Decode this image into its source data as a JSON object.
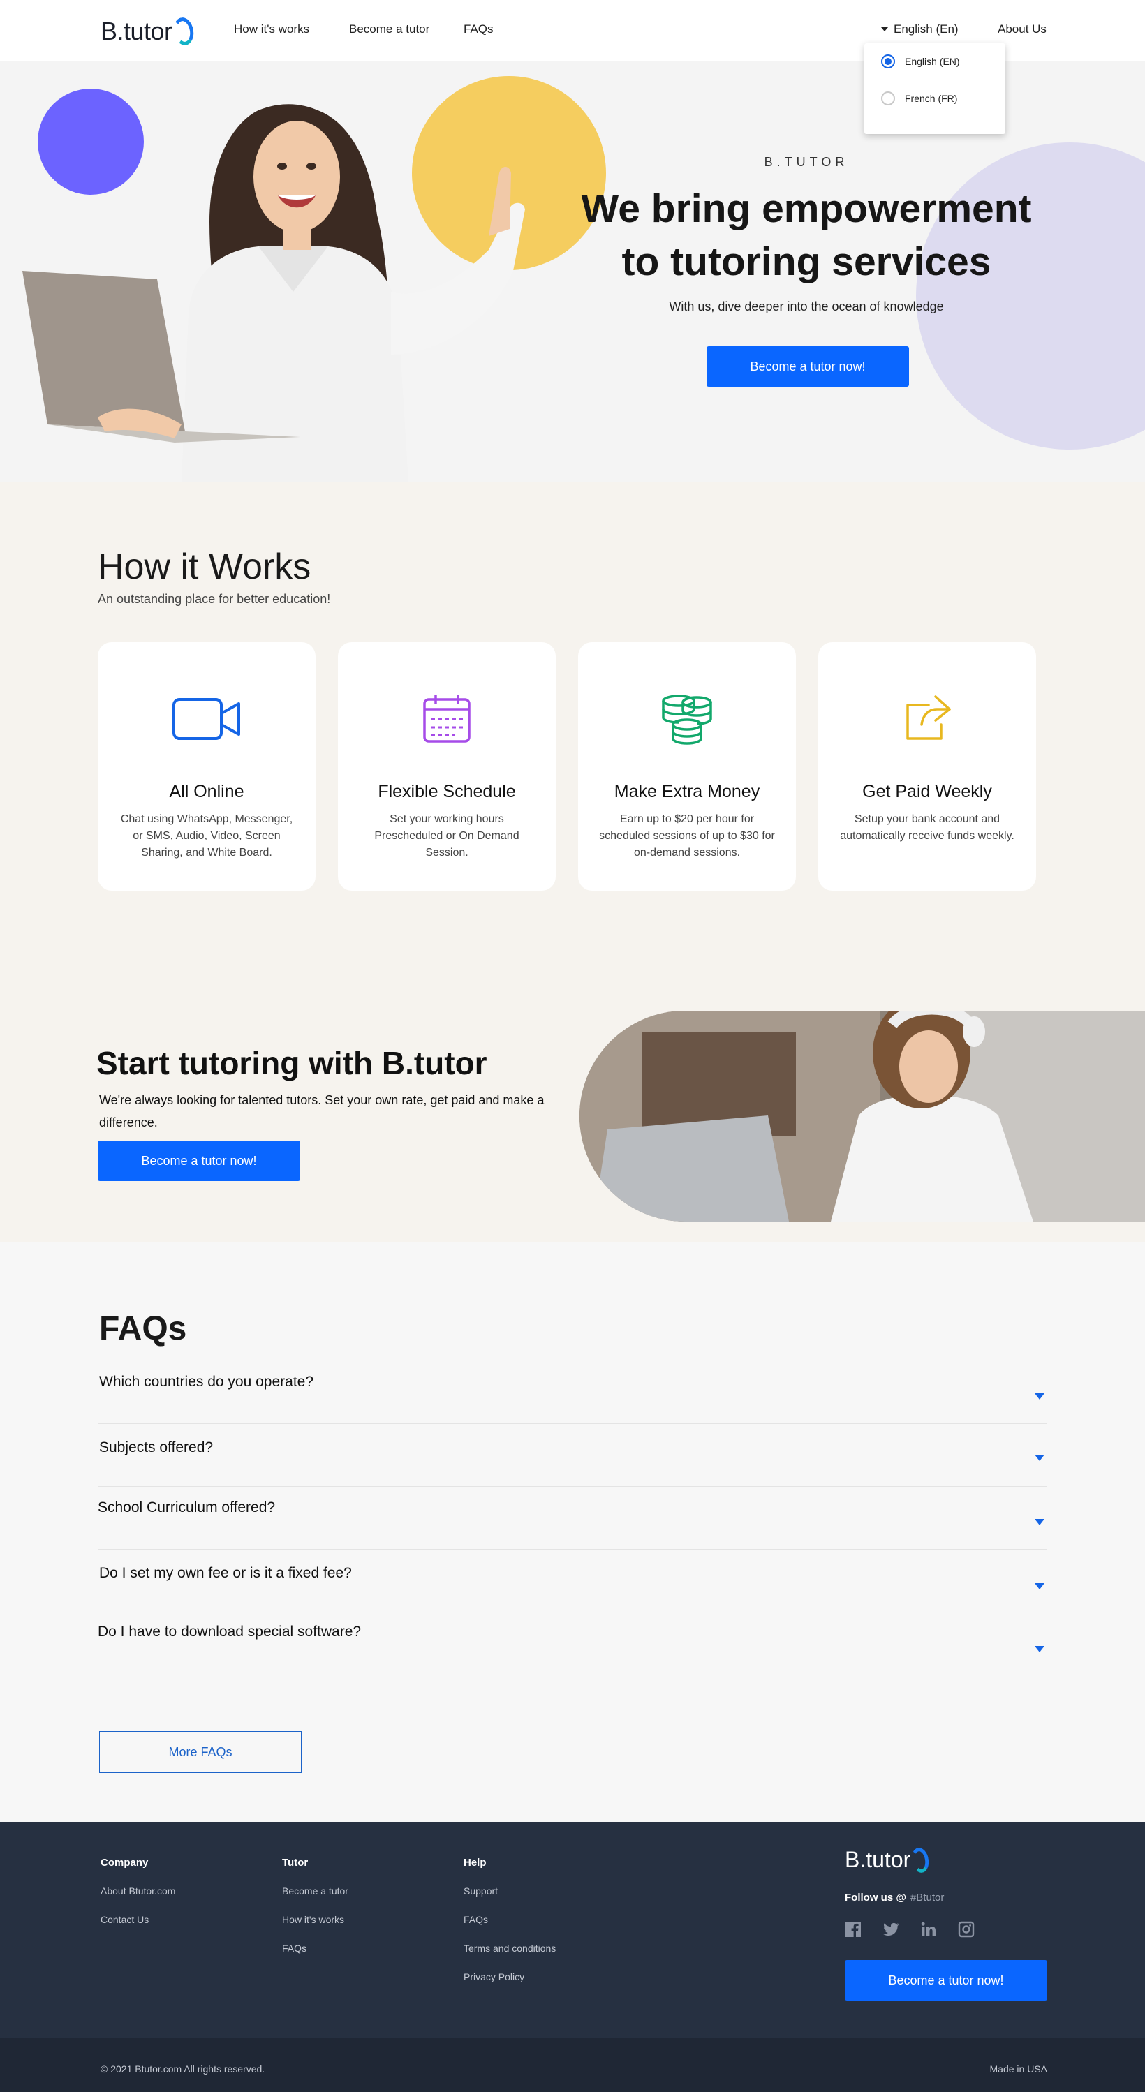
{
  "nav": {
    "logo": "B.tutor",
    "links": [
      "How it's works",
      "Become a tutor",
      "FAQs"
    ],
    "language": "English (En)",
    "about": "About Us",
    "language_menu": [
      {
        "label": "English (EN)",
        "selected": true
      },
      {
        "label": "French (FR)",
        "selected": false
      }
    ]
  },
  "hero": {
    "eyebrow": "B.TUTOR",
    "title_line1": "We bring empowerment",
    "title_line2": "to tutoring services",
    "subtitle": "With us, dive deeper into the ocean of knowledge",
    "cta": "Become a tutor now!"
  },
  "how": {
    "title": "How it Works",
    "subtitle": "An outstanding place for better education!",
    "cards": [
      {
        "icon": "video-camera-icon",
        "color": "#1565e6",
        "title": "All Online",
        "desc": "Chat using WhatsApp, Messenger, or SMS, Audio, Video, Screen Sharing, and White Board."
      },
      {
        "icon": "calendar-icon",
        "color": "#a64ce8",
        "title": "Flexible Schedule",
        "desc": "Set your working hours Prescheduled or On Demand Session."
      },
      {
        "icon": "coins-icon",
        "color": "#12a86b",
        "title": "Make Extra Money",
        "desc": "Earn up to $20 per hour for scheduled sessions of up to $30 for on-demand sessions."
      },
      {
        "icon": "share-icon",
        "color": "#e8b820",
        "title": "Get Paid Weekly",
        "desc": "Setup your bank account and automatically receive funds weekly."
      }
    ]
  },
  "start": {
    "title_prefix": "Start tutoring with ",
    "title_brand": "B.tutor",
    "text": "We're always looking for talented tutors. Set your own rate, get paid and make a difference.",
    "cta": "Become a tutor now!"
  },
  "faq": {
    "title": "FAQs",
    "items": [
      "Which countries do you operate?",
      "Subjects offered?",
      "School Curriculum offered?",
      "Do I set my own fee or is it a fixed fee?",
      "Do I have to download special software?"
    ],
    "more": "More FAQs"
  },
  "footer": {
    "company": {
      "title": "Company",
      "links": [
        "About Btutor.com",
        "Contact Us"
      ]
    },
    "tutor": {
      "title": "Tutor",
      "links": [
        "Become a tutor",
        "How it's works",
        "FAQs"
      ]
    },
    "help": {
      "title": "Help",
      "links": [
        "Support",
        "FAQs",
        "Terms and conditions",
        "Privacy Policy"
      ]
    },
    "logo": "B.tutor",
    "follow_label": "Follow us @",
    "follow_handle": "#Btutor",
    "socials": [
      "facebook-icon",
      "twitter-icon",
      "linkedin-icon",
      "instagram-icon"
    ],
    "cta": "Become a tutor now!",
    "copyright": "© 2021 Btutor.com  All rights reserved.",
    "made_in": "Made in USA"
  },
  "colors": {
    "primary": "#0a66ff",
    "footer_bg": "#263041",
    "accent_yellow": "#f5cd5f",
    "accent_purple": "#6c63ff"
  }
}
